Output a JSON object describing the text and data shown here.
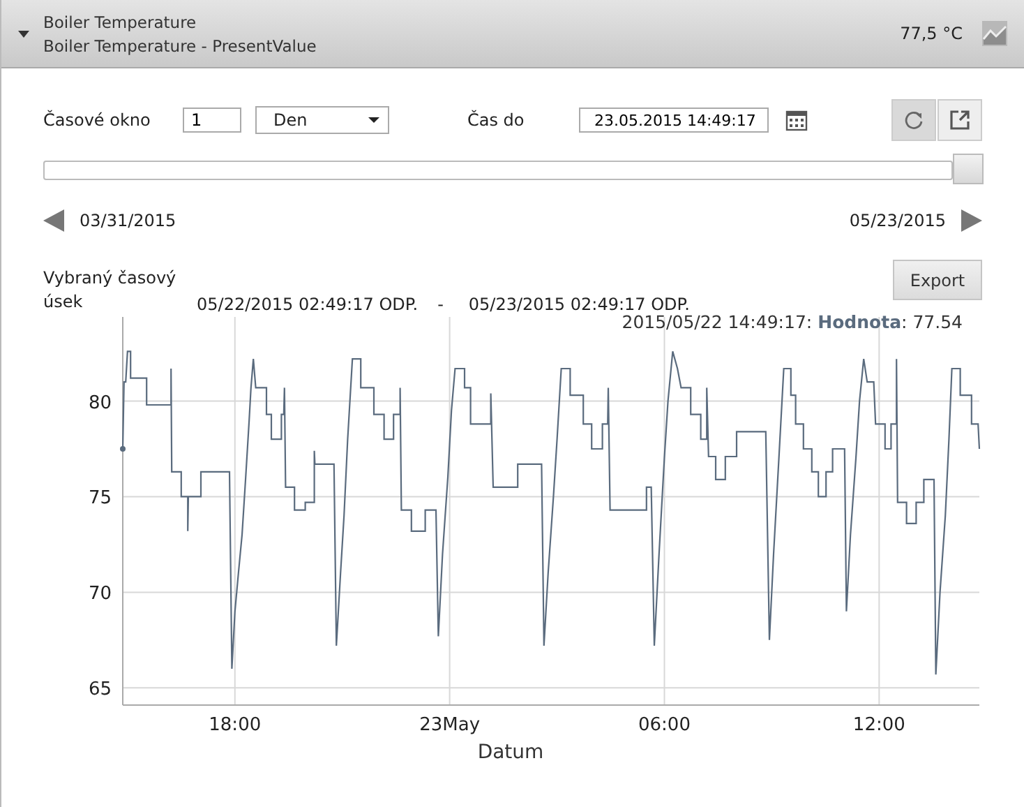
{
  "header": {
    "expanded": true,
    "title": "Boiler Temperature",
    "subtitle": "Boiler Temperature - PresentValue",
    "value": "77,5 °C"
  },
  "controls": {
    "window_label": "Časové okno",
    "window_value": "1",
    "unit": "Den",
    "until_label": "Čas do",
    "until_value": "23.05.2015 14:49:17"
  },
  "range": {
    "level": 1.0,
    "start": "03/31/2015",
    "end": "05/23/2015"
  },
  "selection": {
    "label": "Vybraný časový úsek",
    "from": "05/22/2015 02:49:17 ODP.",
    "separator": "-",
    "to": "05/23/2015 02:49:17 ODP.",
    "export": "Export"
  },
  "chart": {
    "tooltip": {
      "time": "2015/05/22 14:49:17:",
      "value": ": 77.54"
    },
    "chart_data": {
      "type": "line",
      "grid": true,
      "xlabel": "Datum",
      "xlim": [
        "2015-05-22T14:52",
        "2015-05-23T14:48"
      ],
      "ylim": [
        64.1,
        84.4
      ],
      "yticks": [
        65,
        70,
        75,
        80
      ],
      "xticks": [
        {
          "value": "2015-05-22T18:00",
          "label": "18:00"
        },
        {
          "value": "2015-05-23T00:00",
          "label": "23May"
        },
        {
          "value": "2015-05-23T06:00",
          "label": "06:00"
        },
        {
          "value": "2015-05-23T12:00",
          "label": "12:00"
        }
      ],
      "x": [
        "2015-05-22T14:52",
        "2015-05-22T14:54",
        "2015-05-22T14:57",
        "2015-05-22T15:00",
        "2015-05-22T15:05",
        "2015-05-22T15:05",
        "2015-05-22T15:32",
        "2015-05-22T15:32",
        "2015-05-22T16:13",
        "2015-05-22T16:13",
        "2015-05-22T16:14",
        "2015-05-22T16:30",
        "2015-05-22T16:30",
        "2015-05-22T16:41",
        "2015-05-22T16:41",
        "2015-05-22T16:42",
        "2015-05-22T17:03",
        "2015-05-22T17:03",
        "2015-05-22T17:51",
        "2015-05-22T17:55",
        "2015-05-22T18:00",
        "2015-05-22T18:06",
        "2015-05-22T18:12",
        "2015-05-22T18:18",
        "2015-05-22T18:24",
        "2015-05-22T18:27",
        "2015-05-22T18:31",
        "2015-05-22T18:35",
        "2015-05-22T18:53",
        "2015-05-22T18:53",
        "2015-05-22T19:01",
        "2015-05-22T19:01",
        "2015-05-22T19:18",
        "2015-05-22T19:18",
        "2015-05-22T19:22",
        "2015-05-22T19:23",
        "2015-05-22T19:25",
        "2015-05-22T19:40",
        "2015-05-22T19:40",
        "2015-05-22T19:58",
        "2015-05-22T19:58",
        "2015-05-22T20:13",
        "2015-05-22T20:13",
        "2015-05-22T20:14",
        "2015-05-22T20:46",
        "2015-05-22T20:50",
        "2015-05-22T20:57",
        "2015-05-22T21:03",
        "2015-05-22T21:09",
        "2015-05-22T21:17",
        "2015-05-22T21:31",
        "2015-05-22T21:31",
        "2015-05-22T21:53",
        "2015-05-22T21:53",
        "2015-05-22T22:10",
        "2015-05-22T22:10",
        "2015-05-22T22:26",
        "2015-05-22T22:26",
        "2015-05-22T22:37",
        "2015-05-22T22:37",
        "2015-05-22T22:39",
        "2015-05-22T22:56",
        "2015-05-22T22:56",
        "2015-05-22T23:19",
        "2015-05-22T23:19",
        "2015-05-22T23:37",
        "2015-05-22T23:41",
        "2015-05-22T23:48",
        "2015-05-22T23:57",
        "2015-05-23T00:03",
        "2015-05-23T00:09",
        "2015-05-23T00:25",
        "2015-05-23T00:25",
        "2015-05-23T00:35",
        "2015-05-23T00:35",
        "2015-05-23T01:09",
        "2015-05-23T01:09",
        "2015-05-23T01:13",
        "2015-05-23T01:54",
        "2015-05-23T01:54",
        "2015-05-23T02:34",
        "2015-05-23T02:38",
        "2015-05-23T02:45",
        "2015-05-23T02:54",
        "2015-05-23T03:00",
        "2015-05-23T03:07",
        "2015-05-23T03:22",
        "2015-05-23T03:22",
        "2015-05-23T03:44",
        "2015-05-23T03:44",
        "2015-05-23T03:58",
        "2015-05-23T03:58",
        "2015-05-23T04:16",
        "2015-05-23T04:16",
        "2015-05-23T04:25",
        "2015-05-23T04:26",
        "2015-05-23T04:29",
        "2015-05-23T05:30",
        "2015-05-23T05:30",
        "2015-05-23T05:38",
        "2015-05-23T05:43",
        "2015-05-23T05:51",
        "2015-05-23T06:00",
        "2015-05-23T06:06",
        "2015-05-23T06:14",
        "2015-05-23T06:22",
        "2015-05-23T06:28",
        "2015-05-23T06:44",
        "2015-05-23T06:44",
        "2015-05-23T07:01",
        "2015-05-23T07:01",
        "2015-05-23T07:11",
        "2015-05-23T07:11",
        "2015-05-23T07:14",
        "2015-05-23T07:26",
        "2015-05-23T07:26",
        "2015-05-23T07:42",
        "2015-05-23T07:42",
        "2015-05-23T08:01",
        "2015-05-23T08:01",
        "2015-05-23T08:50",
        "2015-05-23T08:56",
        "2015-05-23T09:03",
        "2015-05-23T09:12",
        "2015-05-23T09:20",
        "2015-05-23T09:32",
        "2015-05-23T09:32",
        "2015-05-23T09:40",
        "2015-05-23T09:40",
        "2015-05-23T09:53",
        "2015-05-23T09:53",
        "2015-05-23T10:07",
        "2015-05-23T10:07",
        "2015-05-23T10:18",
        "2015-05-23T10:18",
        "2015-05-23T10:31",
        "2015-05-23T10:31",
        "2015-05-23T10:42",
        "2015-05-23T10:42",
        "2015-05-23T11:02",
        "2015-05-23T11:05",
        "2015-05-23T11:12",
        "2015-05-23T11:21",
        "2015-05-23T11:27",
        "2015-05-23T11:34",
        "2015-05-23T11:40",
        "2015-05-23T11:51",
        "2015-05-23T11:54",
        "2015-05-23T12:10",
        "2015-05-23T12:10",
        "2015-05-23T12:20",
        "2015-05-23T12:20",
        "2015-05-23T12:29",
        "2015-05-23T12:29",
        "2015-05-23T12:31",
        "2015-05-23T12:46",
        "2015-05-23T12:46",
        "2015-05-23T13:02",
        "2015-05-23T13:02",
        "2015-05-23T13:15",
        "2015-05-23T13:15",
        "2015-05-23T13:32",
        "2015-05-23T13:35",
        "2015-05-23T13:42",
        "2015-05-23T13:51",
        "2015-05-23T13:57",
        "2015-05-23T14:02",
        "2015-05-23T14:16",
        "2015-05-23T14:16",
        "2015-05-23T14:35",
        "2015-05-23T14:35",
        "2015-05-23T14:46",
        "2015-05-23T14:48"
      ],
      "series": [
        {
          "name": "Hodnota",
          "color": "#5a6b7e",
          "values": [
            77.5,
            81,
            81,
            82.6,
            82.6,
            81.2,
            81.2,
            79.8,
            79.8,
            81.7,
            76.3,
            76.3,
            75,
            75,
            73.2,
            75,
            75,
            76.3,
            76.3,
            66,
            69,
            71,
            73,
            76,
            79,
            80.7,
            82.2,
            80.7,
            80.7,
            79.3,
            79.3,
            78,
            78,
            79.3,
            79.3,
            80.7,
            75.5,
            75.5,
            74.3,
            74.3,
            74.7,
            74.7,
            77.4,
            76.7,
            76.7,
            67.2,
            71,
            74,
            78,
            82.2,
            82.2,
            80.7,
            80.7,
            79.3,
            79.3,
            78,
            78,
            79.3,
            79.3,
            80.7,
            74.3,
            74.3,
            73.2,
            73.2,
            74.3,
            74.3,
            67.7,
            72,
            76,
            79.5,
            81.7,
            81.7,
            80.7,
            80.7,
            78.8,
            78.8,
            80.4,
            75.5,
            75.5,
            76.7,
            76.7,
            67.2,
            71,
            75,
            78,
            81.7,
            81.7,
            80.3,
            80.3,
            78.8,
            78.8,
            77.5,
            77.5,
            78.8,
            78.8,
            80.7,
            74.3,
            74.3,
            75.5,
            75.5,
            67.2,
            72,
            77,
            80,
            82.6,
            81.7,
            80.7,
            80.7,
            79.3,
            79.3,
            78,
            78,
            80.7,
            77.1,
            77.1,
            75.9,
            75.9,
            77.1,
            77.1,
            78.4,
            78.4,
            67.5,
            72,
            77,
            81.7,
            81.7,
            80.3,
            80.3,
            78.8,
            78.8,
            77.5,
            77.5,
            76.3,
            76.3,
            75,
            75,
            76.3,
            76.3,
            77.5,
            77.5,
            69,
            73,
            77,
            80,
            82.2,
            81,
            81,
            78.8,
            78.8,
            77.5,
            77.5,
            78.8,
            78.8,
            82.2,
            74.7,
            74.7,
            73.6,
            73.6,
            74.7,
            74.7,
            75.9,
            75.9,
            65.7,
            70,
            74,
            78,
            81.7,
            81.7,
            80.3,
            80.3,
            78.8,
            78.8,
            77.5
          ]
        }
      ]
    }
  }
}
